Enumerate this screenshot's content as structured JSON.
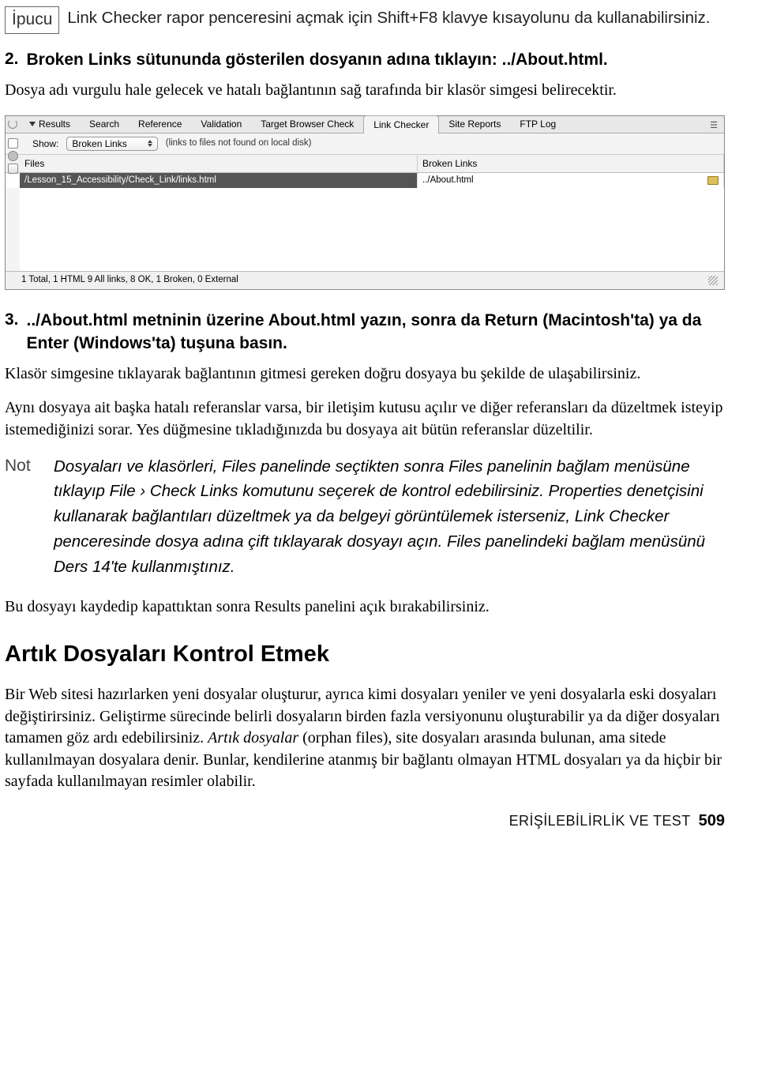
{
  "hint": {
    "label": "İpucu",
    "text": "Link Checker rapor penceresini açmak için Shift+F8 klavye kısayolunu da kullanabilirsiniz."
  },
  "step2": {
    "number": "2.",
    "text": "Broken Links sütununda gösterilen dosyanın adına tıklayın: ../About.html.",
    "desc": "Dosya adı vurgulu hale gelecek ve hatalı bağlantının sağ tarafında bir klasör simgesi belirecektir."
  },
  "panel": {
    "tabs": [
      "Results",
      "Search",
      "Reference",
      "Validation",
      "Target Browser Check",
      "Link Checker",
      "Site Reports",
      "FTP Log"
    ],
    "active_tab_index": 5,
    "show_label": "Show:",
    "dropdown_value": "Broken Links",
    "parenthetical": "(links to files not found on local disk)",
    "col_files": "Files",
    "col_broken": "Broken Links",
    "row_file": "/Lesson_15_Accessibility/Check_Link/links.html",
    "row_broken": "../About.html",
    "status": "1 Total, 1 HTML  9 All links, 8 OK, 1 Broken, 0 External"
  },
  "step3": {
    "number": "3.",
    "text": "../About.html metninin üzerine About.html yazın, sonra da Return (Macintosh'ta) ya da Enter (Windows'ta) tuşuna basın.",
    "para1": "Klasör simgesine tıklayarak bağlantının gitmesi gereken doğru dosyaya bu şekilde de ulaşabilirsiniz.",
    "para2": "Aynı dosyaya ait başka hatalı referanslar varsa, bir iletişim kutusu açılır ve diğer referansları da düzeltmek isteyip istemediğinizi sorar. Yes düğmesine tıkladığınızda bu dosyaya ait bütün referanslar düzeltilir."
  },
  "note": {
    "label": "Not",
    "text": "Dosyaları ve klasörleri, Files panelinde seçtikten sonra Files panelinin bağlam menüsüne tıklayıp File › Check Links komutunu seçerek de kontrol edebilirsiniz. Properties denetçisini kullanarak bağlantıları düzeltmek ya da belgeyi görüntülemek isterseniz, Link Checker penceresinde dosya adına çift tıklayarak dosyayı açın. Files panelindeki bağlam menüsünü Ders 14'te kullanmıştınız."
  },
  "after_note_para": "Bu dosyayı kaydedip kapattıktan sonra Results panelini açık bırakabilirsiniz.",
  "section_heading": "Artık Dosyaları Kontrol Etmek",
  "section_body_head": "Bir Web sitesi hazırlarken yeni dosyalar oluşturur, ayrıca kimi dosyaları yeniler ve yeni dosyalarla eski dosyaları değiştirirsiniz. Geliştirme sürecinde belirli dosyaların birden fazla versiyonunu oluşturabilir ya da diğer dosyaları tamamen göz ardı edebilirsiniz. ",
  "section_body_emph": "Artık dosyalar",
  "section_body_tail": " (orphan files), site dosyaları arasında bulunan, ama sitede kullanılmayan dosyalara denir. Bunlar, kendilerine atanmış bir bağlantı olmayan HTML dosyaları ya da hiçbir bir sayfada kullanılmayan resimler olabilir.",
  "footer": {
    "title": "ERİŞİLEBİLİRLİK VE TEST",
    "page": "509"
  }
}
